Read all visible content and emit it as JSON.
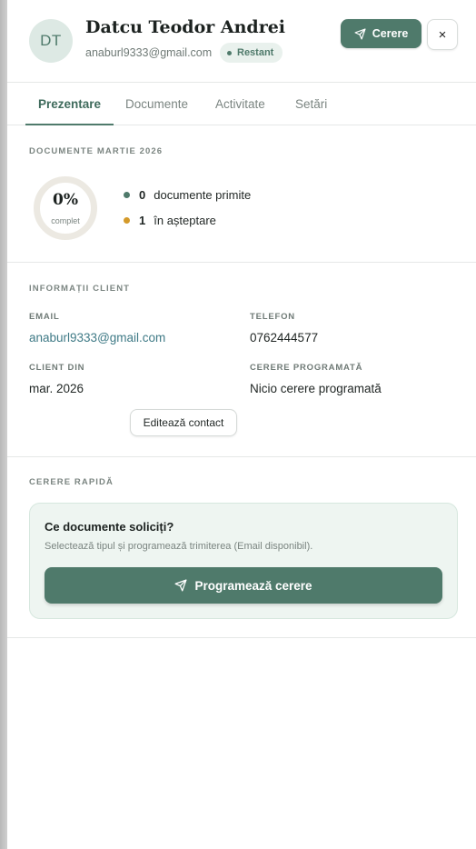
{
  "header": {
    "avatar_initials": "DT",
    "client_name": "Datcu Teodor Andrei",
    "client_email": "anaburl9333@gmail.com",
    "status_label": "Restant",
    "request_button_label": "Cerere",
    "close_label": "×"
  },
  "tabs": [
    {
      "label": "Prezentare",
      "active": true
    },
    {
      "label": "Documente",
      "active": false
    },
    {
      "label": "Activitate",
      "active": false
    },
    {
      "label": "Setări",
      "active": false
    }
  ],
  "documents": {
    "section_title": "DOCUMENTE MARTIE 2026",
    "percent": "0%",
    "percent_caption": "complet",
    "received_count": "0",
    "received_label": "documente primite",
    "pending_count": "1",
    "pending_label": "în așteptare"
  },
  "client_info": {
    "section_title": "INFORMAȚII CLIENT",
    "email_label": "EMAIL",
    "email_value": "anaburl9333@gmail.com",
    "phone_label": "TELEFON",
    "phone_value": "0762444577",
    "client_since_label": "CLIENT DIN",
    "client_since_value": "mar. 2026",
    "scheduled_label": "CERERE PROGRAMATĂ",
    "scheduled_value": "Nicio cerere programată",
    "edit_button_label": "Editează contact"
  },
  "quick_request": {
    "section_title": "CERERE RAPIDĂ",
    "card_title": "Ce documente soliciți?",
    "card_subtitle": "Selectează tipul și programează trimiterea (Email disponibil).",
    "schedule_button_label": "Programează cerere"
  },
  "colors": {
    "accent": "#4f7a6b",
    "received_dot": "#4f7a6b",
    "pending_dot": "#d49a2a",
    "link": "#3f7a86"
  }
}
